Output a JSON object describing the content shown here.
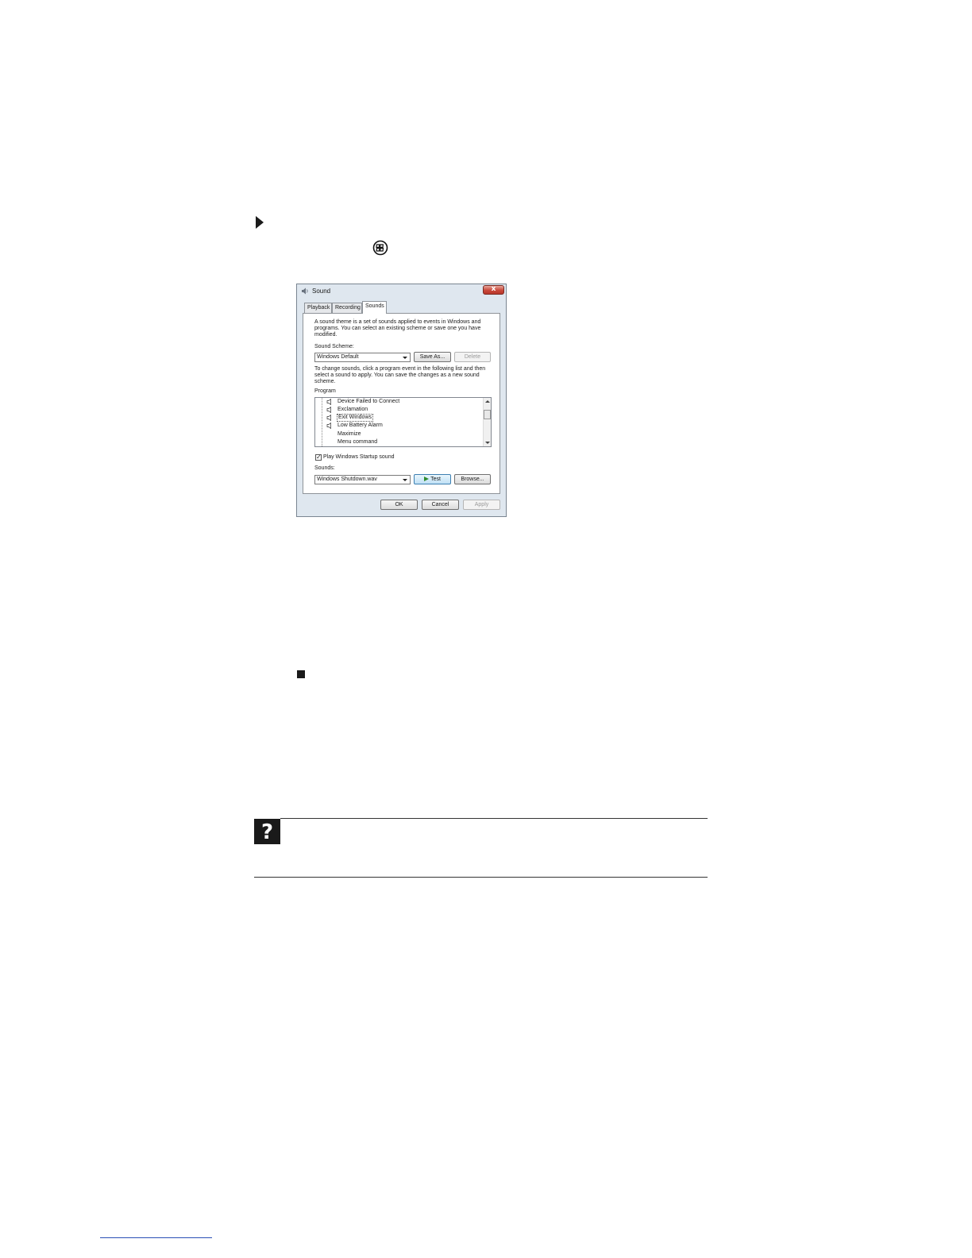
{
  "dialog": {
    "title": "Sound",
    "close_glyph": "x",
    "tabs": [
      "Playback",
      "Recording",
      "Sounds"
    ],
    "active_tab": "Sounds",
    "description": "A sound theme is a set of sounds applied to events in Windows and programs. You can select an existing scheme or save one you have modified.",
    "scheme_label": "Sound Scheme:",
    "scheme_value": "Windows Default",
    "save_as_label": "Save As...",
    "delete_label": "Delete",
    "change_text": "To change sounds, click a program event in the following list and then select a sound to apply. You can save the changes as a new sound scheme.",
    "program_label": "Program",
    "events": [
      {
        "label": "Device Failed to Connect",
        "has_sound": true
      },
      {
        "label": "Exclamation",
        "has_sound": true
      },
      {
        "label": "Exit Windows",
        "has_sound": true,
        "selected": true
      },
      {
        "label": "Low Battery Alarm",
        "has_sound": true
      },
      {
        "label": "Maximize",
        "has_sound": false
      },
      {
        "label": "Menu command",
        "has_sound": false
      }
    ],
    "startup_checkbox_label": "Play Windows Startup sound",
    "startup_checked": true,
    "sounds_label": "Sounds:",
    "sounds_value": "Windows Shutdown.wav",
    "test_label": "Test",
    "browse_label": "Browse...",
    "ok_label": "OK",
    "cancel_label": "Cancel",
    "apply_label": "Apply"
  },
  "help_box": {
    "glyph": "?"
  }
}
